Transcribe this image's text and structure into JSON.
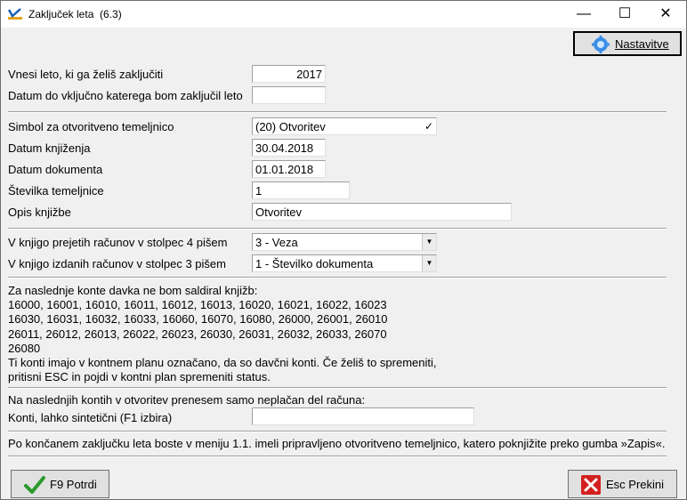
{
  "window": {
    "title": "Zaključek leta",
    "version": "(6.3)",
    "minimize": "—",
    "maximize": "☐",
    "close": "✕"
  },
  "toolbar": {
    "settings_label": "Nastavitve"
  },
  "form": {
    "year_label": "Vnesi leto, ki ga želiš zaključiti",
    "year_value": "2017",
    "close_date_label": "Datum do vključno katerega bom zaključil leto",
    "close_date_value": "",
    "symbol_label": "Simbol za otvoritveno temeljnico",
    "symbol_value": "(20) Otvoritev",
    "symbol_check": "✓",
    "posting_date_label": "Datum knjiženja",
    "posting_date_value": "30.04.2018",
    "document_date_label": "Datum dokumenta",
    "document_date_value": "01.01.2018",
    "journal_number_label": "Številka temeljnice",
    "journal_number_value": "1",
    "posting_desc_label": "Opis knjižbe",
    "posting_desc_value": "Otvoritev",
    "received_invoices_label": "V knjigo prejetih računov v stolpec 4 pišem",
    "received_invoices_value": "3 - Veza",
    "issued_invoices_label": "V knjigo izdanih računov v stolpec 3 pišem",
    "issued_invoices_value": "1 - Številko dokumenta"
  },
  "tax_info": {
    "lines": [
      "Za naslednje konte davka ne bom saldiral knjižb:",
      "16000, 16001, 16010, 16011, 16012, 16013, 16020, 16021, 16022, 16023",
      "16030, 16031, 16032, 16033, 16060, 16070, 16080, 26000, 26001, 26010",
      "26011, 26012, 26013, 26022, 26023, 26030, 26031, 26032, 26033, 26070",
      "26080",
      "Ti konti imajo v kontnem planu označano, da so davčni konti. Če želiš to spremeniti,",
      "pritisni ESC in pojdi v kontni plan spremeniti status."
    ]
  },
  "unpaid": {
    "note": "Na naslednjih kontih v otvoritev prenesem samo neplačan del računa:",
    "accounts_label": "Konti, lahko sintetični (F1 izbira)",
    "accounts_value": ""
  },
  "footer_note": "Po končanem zaključku leta boste v meniju 1.1. imeli pripravljeno otvoritveno temeljnico, katero poknjižite preko gumba »Zapis«.",
  "buttons": {
    "confirm_label": "F9 Potrdi",
    "cancel_label": "Esc Prekini"
  },
  "colors": {
    "confirm_icon": "#2a9a2a",
    "cancel_icon": "#d42020",
    "settings_icon": "#3a8ee6"
  }
}
